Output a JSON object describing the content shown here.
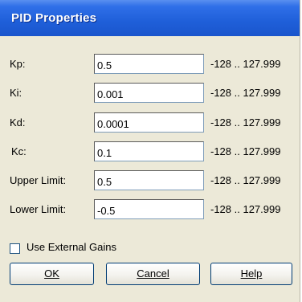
{
  "window": {
    "title": "PID Properties"
  },
  "fields": [
    {
      "label": "Kp:",
      "value": "0.5",
      "range": "-128 .. 127.999"
    },
    {
      "label": "Ki:",
      "value": "0.001",
      "range": "-128 .. 127.999"
    },
    {
      "label": "Kd:",
      "value": "0.0001",
      "range": "-128 .. 127.999"
    },
    {
      "label": "Kc:",
      "value": "0.1",
      "range": "-128 .. 127.999"
    },
    {
      "label": "Upper Limit:",
      "value": "0.5",
      "range": "-128 .. 127.999"
    },
    {
      "label": "Lower Limit:",
      "value": "-0.5",
      "range": "-128 .. 127.999"
    }
  ],
  "checkbox": {
    "label": "Use External Gains",
    "checked": false
  },
  "buttons": {
    "ok": "OK",
    "cancel": "Cancel",
    "help": "Help"
  }
}
